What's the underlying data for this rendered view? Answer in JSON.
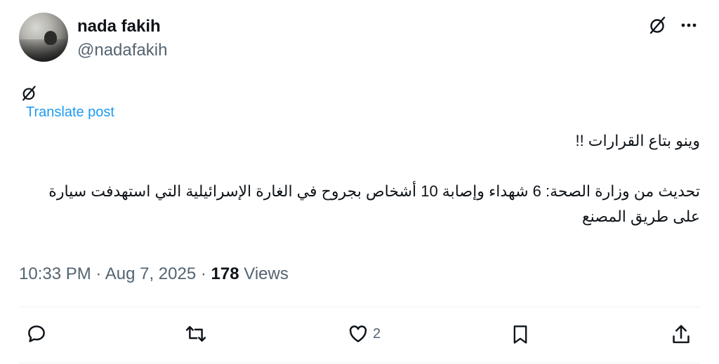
{
  "author": {
    "display_name": "nada fakih",
    "handle": "@nadafakih"
  },
  "icons": {
    "grok": "grok-icon",
    "more": "more-horizontal-icon",
    "reply": "reply-icon",
    "repost": "repost-icon",
    "like": "heart-icon",
    "bookmark": "bookmark-icon",
    "share": "share-icon"
  },
  "translate_label": "Translate post",
  "post": {
    "line1": "وينو بتاع القرارات !!",
    "line2": "تحديث من وزارة الصحة: 6 شهداء وإصابة 10 أشخاص بجروح في الغارة الإسرائيلية التي استهدفت سيارة على طريق المصنع"
  },
  "meta": {
    "time": "10:33 PM",
    "sep1": " · ",
    "date": "Aug 7, 2025",
    "sep2": " · ",
    "views_count": "178",
    "views_label": " Views"
  },
  "actions": {
    "likes_count": "2"
  },
  "colors": {
    "text": "#0f1419",
    "secondary": "#536471",
    "link": "#1d9bf0",
    "divider": "#eff3f4"
  }
}
